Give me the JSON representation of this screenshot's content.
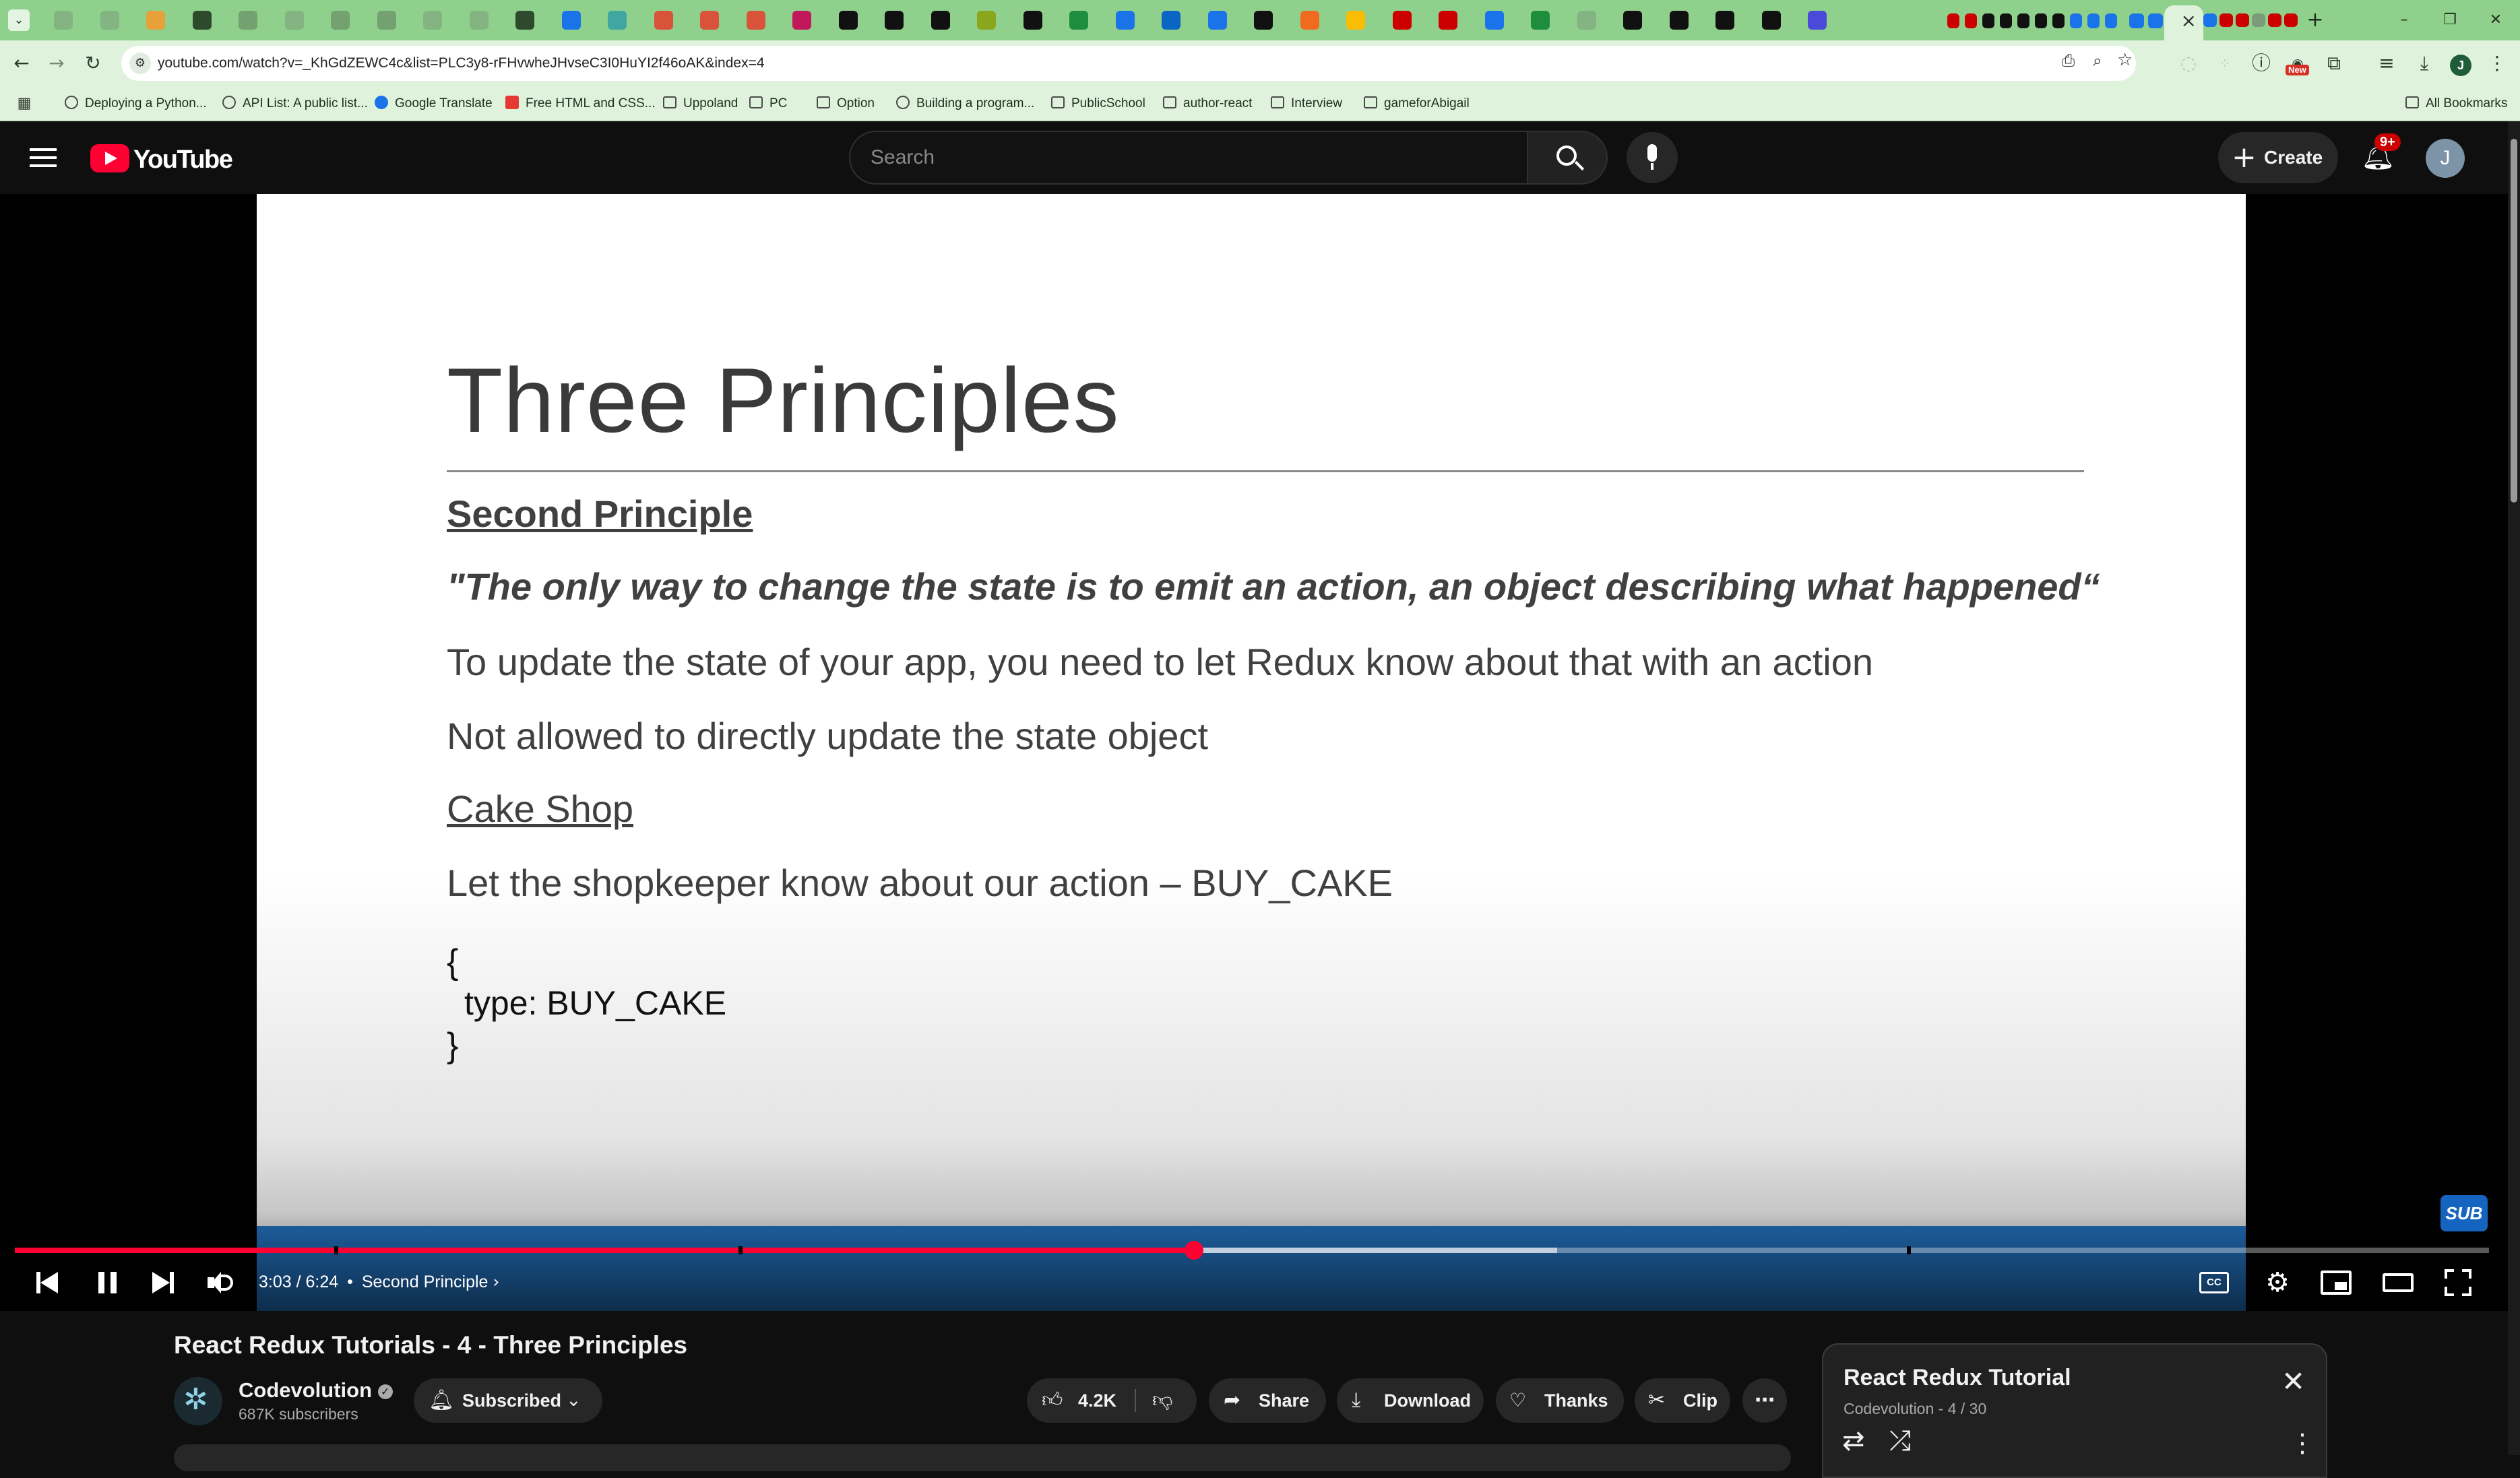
{
  "browser": {
    "url": "youtube.com/watch?v=_KhGdZEWC4c&list=PLC3y8-rFHvwheJHvseC3I0HuYI2f46oAK&index=4",
    "active_tab_close": "×",
    "new_tab": "+",
    "window_minimize": "–",
    "window_restore": "❐",
    "window_close": "✕",
    "profile_initial": "J",
    "new_badge": "New",
    "bookmarks": [
      {
        "label": "Deploying a Python...",
        "icon": "github-icon"
      },
      {
        "label": "API List: A public list...",
        "icon": "api-icon"
      },
      {
        "label": "Google Translate",
        "icon": "translate-icon"
      },
      {
        "label": "Free HTML and CSS...",
        "icon": "page-icon"
      },
      {
        "label": "Uppoland",
        "icon": "folder-icon"
      },
      {
        "label": "PC",
        "icon": "folder-icon"
      },
      {
        "label": "Option",
        "icon": "folder-icon"
      },
      {
        "label": "Building a program...",
        "icon": "im-icon"
      },
      {
        "label": "PublicSchool",
        "icon": "folder-icon"
      },
      {
        "label": "author-react",
        "icon": "folder-icon"
      },
      {
        "label": "Interview",
        "icon": "folder-icon"
      },
      {
        "label": "gameforAbigail",
        "icon": "folder-icon"
      }
    ],
    "all_bookmarks": "All Bookmarks"
  },
  "youtube": {
    "logo_text": "YouTube",
    "search_placeholder": "Search",
    "create_label": "Create",
    "notification_count": "9+",
    "account_initial": "J"
  },
  "slide": {
    "title": "Three Principles",
    "heading": "Second Principle",
    "quote": "\"The only way to change the state is to emit an action, an object describing what happened“",
    "line1": "To update the state of your app, you need to let Redux know about that with an action",
    "line2": "Not allowed to directly update the state object",
    "subheading": "Cake Shop",
    "line3": "Let the shopkeeper know about our action – BUY_CAKE",
    "code_open": "{",
    "code_body": "type: BUY_CAKE",
    "code_close": "}",
    "watermark": "SUB"
  },
  "player": {
    "current_time": "3:03",
    "duration": "6:24",
    "time_display": "3:03 / 6:24",
    "chapter": "Second Principle",
    "progress_fraction": 0.4766,
    "buffered_fraction": 0.6234,
    "progress_color": "#ff0033",
    "cc_label": "CC"
  },
  "video": {
    "title": "React Redux Tutorials - 4 - Three Principles",
    "channel": "Codevolution",
    "subscribers": "687K subscribers",
    "subscribed_label": "Subscribed",
    "likes": "4.2K",
    "share_label": "Share",
    "download_label": "Download",
    "thanks_label": "Thanks",
    "clip_label": "Clip"
  },
  "playlist": {
    "title": "React Redux Tutorial",
    "subtitle": "Codevolution - 4 / 30"
  }
}
